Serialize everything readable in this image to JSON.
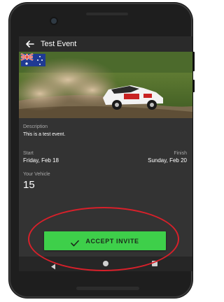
{
  "appbar": {
    "title": "Test Event",
    "back_icon": "arrow-left-icon"
  },
  "hero": {
    "flag_icon": "australia-flag-icon",
    "image": "rally-car-dust-photo"
  },
  "event": {
    "description_label": "Description",
    "description": "This is a test event.",
    "start_label": "Start",
    "start_date": "Friday, Feb 18",
    "finish_label": "Finish",
    "finish_date": "Sunday, Feb 20",
    "vehicle_label": "Your Vehicle",
    "vehicle_number": "15"
  },
  "actions": {
    "accept_label": "ACCEPT INVITE",
    "accept_icon": "check-icon"
  },
  "navbar": {
    "back_icon": "nav-back-icon",
    "home_icon": "nav-home-icon",
    "recents_icon": "nav-recents-icon"
  },
  "colors": {
    "screen_bg": "#333333",
    "accent_green": "#3ecf4a",
    "highlight_red": "#d8202a"
  }
}
